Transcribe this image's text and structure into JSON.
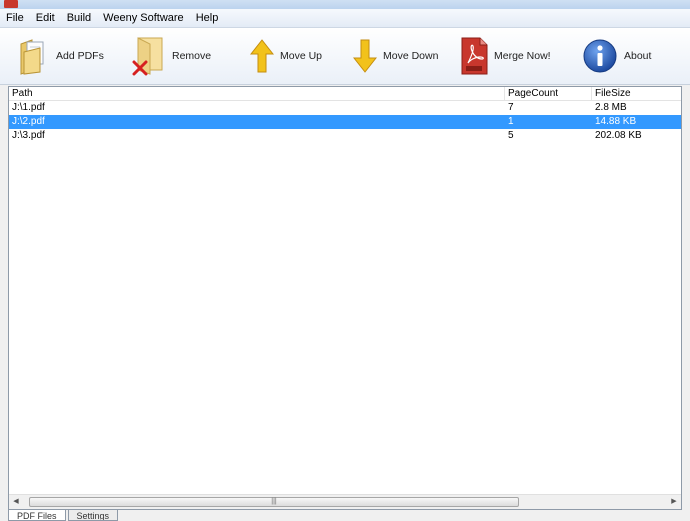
{
  "menu": [
    "File",
    "Edit",
    "Build",
    "Weeny Software",
    "Help"
  ],
  "toolbar": {
    "add_pdfs": "Add PDFs",
    "remove": "Remove",
    "move_up": "Move Up",
    "move_down": "Move Down",
    "merge_now": "Merge Now!",
    "about": "About"
  },
  "columns": [
    "Path",
    "PageCount",
    "FileSize"
  ],
  "rows": [
    {
      "path": "J:\\1.pdf",
      "pages": "7",
      "size": "2.8 MB"
    },
    {
      "path": "J:\\2.pdf",
      "pages": "1",
      "size": "14.88 KB"
    },
    {
      "path": "J:\\3.pdf",
      "pages": "5",
      "size": "202.08 KB"
    }
  ],
  "selected_row": 1,
  "tabs": [
    "PDF Files",
    "Settings"
  ],
  "colors": {
    "selection": "#3399ff",
    "pdf_red": "#c8372d",
    "about_blue": "#2b5fb8",
    "arrow_yellow": "#f2c21b"
  },
  "icons": [
    "folder-add-icon",
    "remove-x-icon",
    "arrow-up-icon",
    "arrow-down-icon",
    "pdf-icon",
    "info-icon"
  ]
}
